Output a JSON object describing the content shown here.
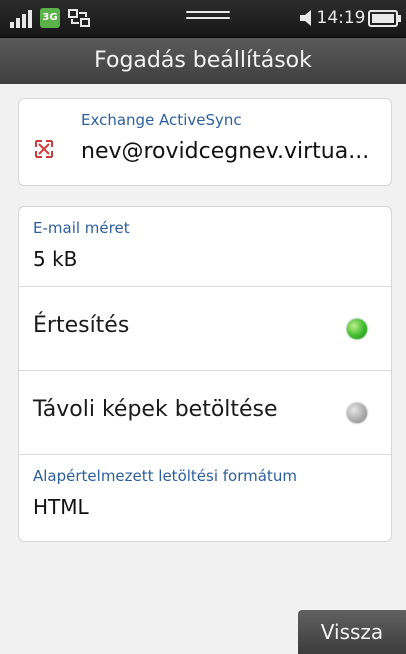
{
  "status_bar": {
    "network_badge": "3G",
    "clock": "14:19",
    "icons": [
      "signal-icon",
      "network-3g-icon",
      "sync-icon",
      "menu-handle-icon",
      "speaker-icon",
      "battery-icon"
    ]
  },
  "header": {
    "title": "Fogadás beállítások"
  },
  "account": {
    "type_label": "Exchange ActiveSync",
    "email": "nev@rovidcegnev.virtua...",
    "icon": "exchange-icon"
  },
  "settings": {
    "email_size": {
      "caption": "E-mail méret",
      "value": "5 kB"
    },
    "notification": {
      "label": "Értesítés",
      "enabled": true
    },
    "remote_images": {
      "label": "Távoli képek betöltése",
      "enabled": false
    },
    "default_format": {
      "caption": "Alapértelmezett letöltési formátum",
      "value": "HTML"
    }
  },
  "footer": {
    "back_label": "Vissza"
  },
  "colors": {
    "caption": "#2c5f9e",
    "toggle_on": "#3dbb2d",
    "toggle_off": "#a8a8a8",
    "header_bg": "#4b4b4b"
  }
}
